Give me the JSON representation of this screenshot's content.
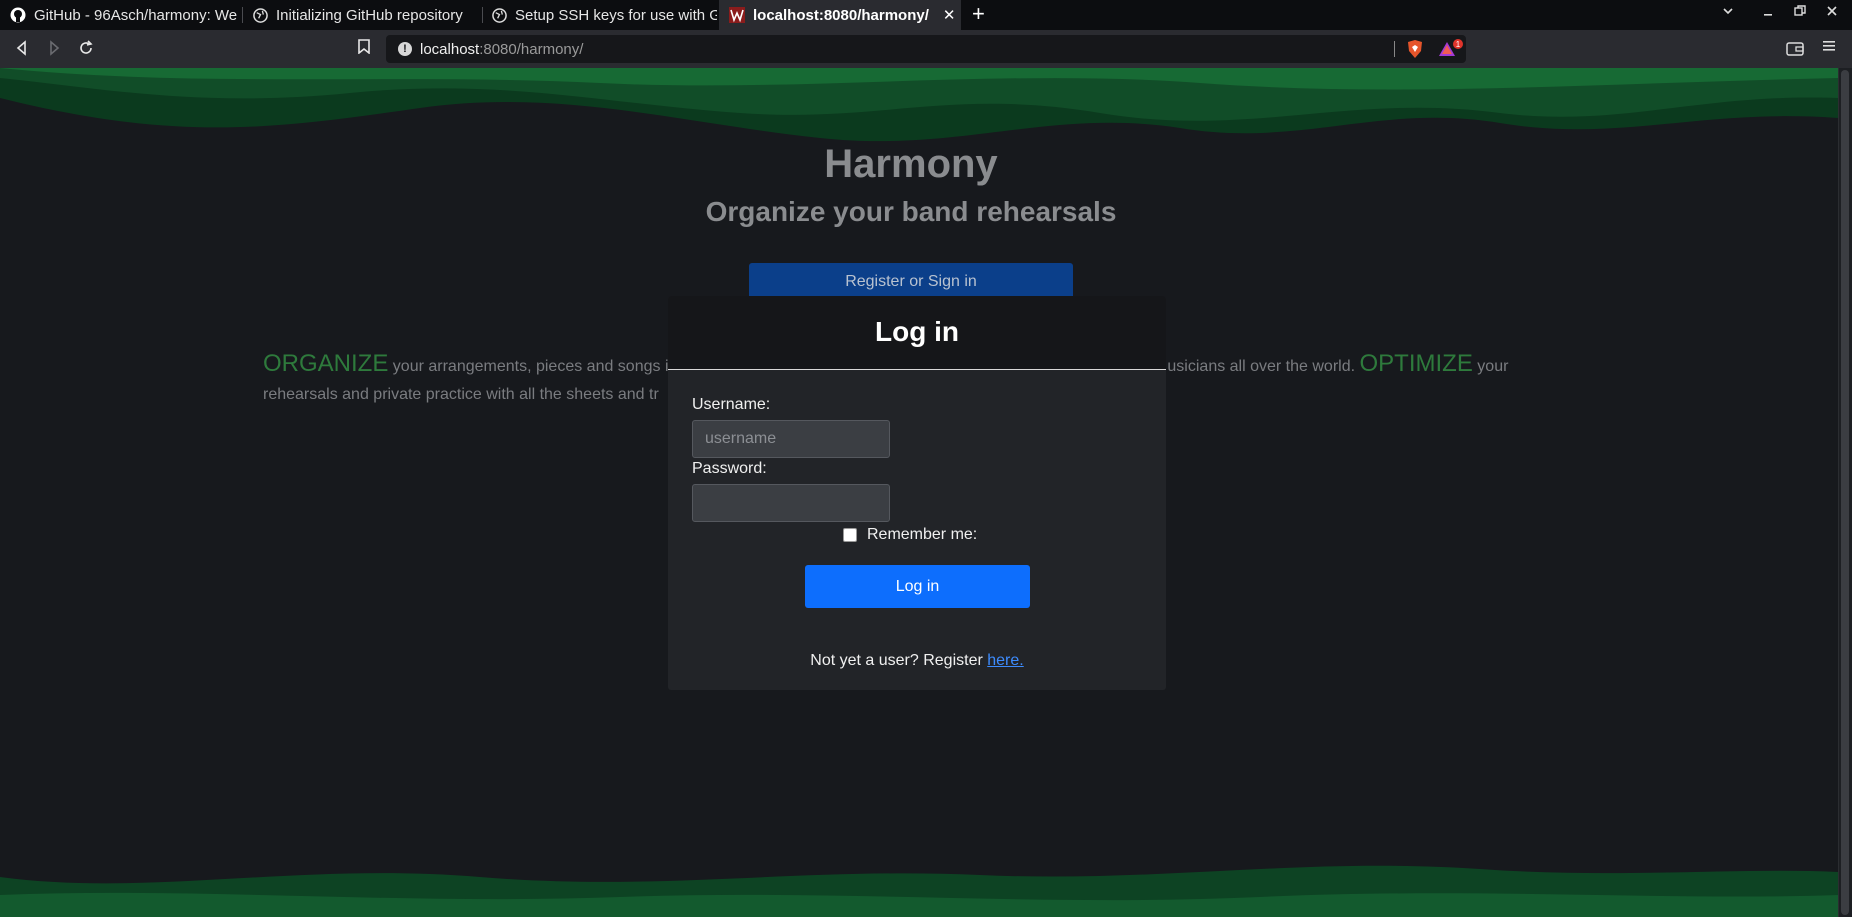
{
  "browser": {
    "tabs": [
      {
        "title": "GitHub - 96Asch/harmony: We",
        "icon": "github-icon"
      },
      {
        "title": "Initializing GitHub repository",
        "icon": "globe-icon"
      },
      {
        "title": "Setup SSH keys for use with G",
        "icon": "globe-icon"
      },
      {
        "title": "localhost:8080/harmony/",
        "icon": "page-favicon",
        "active": true
      }
    ],
    "close_glyph": "✕",
    "new_tab_glyph": "+",
    "url_host": "localhost",
    "url_rest": ":8080/harmony/",
    "alert_count": "1"
  },
  "hero": {
    "title": "Harmony",
    "subtitle": "Organize your band rehearsals",
    "register_button": "Register or Sign in"
  },
  "intro": {
    "hl1": "ORGANIZE",
    "text1": " your arrangements, pieces and songs in",
    "text2": "usicians all over the world. ",
    "hl2": "OPTIMIZE",
    "text3": " your",
    "text4": "rehearsals and private practice with all the sheets and tr"
  },
  "login_modal": {
    "title": "Log in",
    "username_label": "Username:",
    "username_placeholder": "username",
    "password_label": "Password:",
    "remember_label": "Remember me:",
    "submit_label": "Log in",
    "footer_prefix": "Not yet a user? Register ",
    "footer_link": "here."
  },
  "colors": {
    "accent_green": "#2e7a3c",
    "primary_blue": "#0d6efd",
    "wave_green": "#0e4a25"
  }
}
